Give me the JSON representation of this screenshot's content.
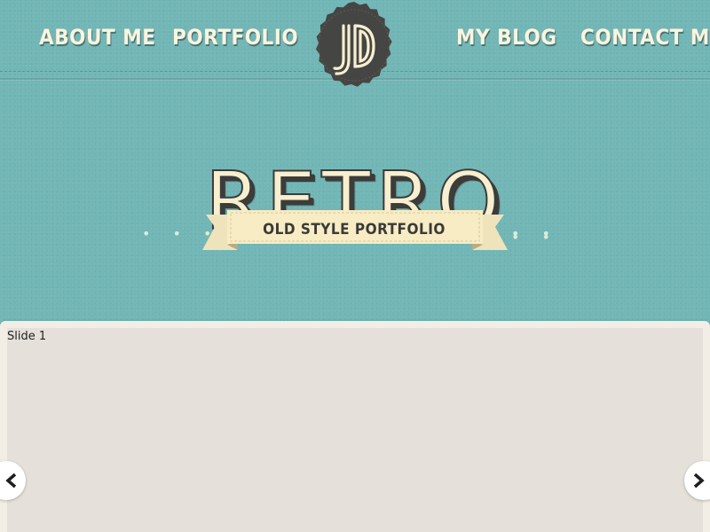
{
  "nav": {
    "items": [
      {
        "label": "ABOUT ME"
      },
      {
        "label": "PORTFOLIO"
      },
      {
        "label": "MY BLOG"
      },
      {
        "label": "CONTACT ME"
      }
    ],
    "logo": {
      "initials": "JD"
    }
  },
  "hero": {
    "title": "RETRO",
    "ribbon_text": "OLD STYLE PORTFOLIO",
    "dots_left": "• • • •",
    "dots_right": "• • • •"
  },
  "slider": {
    "slide_label": "Slide 1",
    "prev_icon": "chevron-left-icon",
    "next_icon": "chevron-right-icon"
  },
  "colors": {
    "background": "#72b6b6",
    "cream": "#f7efcf",
    "dark": "#3c3c3a",
    "slider_bg": "#e5e1da"
  }
}
